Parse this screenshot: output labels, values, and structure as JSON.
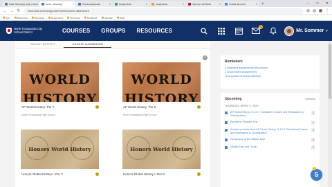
{
  "browser": {
    "tabs": [
      {
        "label": "Public Schoology Login | Schoo",
        "color": "#3f7fc0",
        "active": false
      },
      {
        "label": "Home | Schoology",
        "color": "#3f7fc0",
        "active": true
      },
      {
        "label": "Course Assignment",
        "color": "#3f7fc0",
        "active": false
      },
      {
        "label": "Google Drive",
        "color": "#1fa463",
        "active": false
      },
      {
        "label": "Assignments",
        "color": "#e7a33c",
        "active": false
      },
      {
        "label": "Sommer's AP World",
        "color": "#c8102e",
        "active": false
      },
      {
        "label": "Untitled document",
        "color": "#4285f4",
        "active": false
      }
    ],
    "url": "ntschools.schoology.com/home/course-dashboard",
    "bookmarks": [
      "Apps",
      "Bookmarks",
      "Schoology",
      "Google Drive",
      "AP Central",
      "Gradebook",
      "Calendar",
      "Other"
    ]
  },
  "header": {
    "district": "North Tonawanda City School District",
    "nav": [
      "COURSES",
      "GROUPS",
      "RESOURCES"
    ],
    "message_count": "3",
    "user": "Mr. Sommer"
  },
  "main": {
    "tabs": [
      "RECENT ACTIVITY",
      "COURSE DASHBOARD"
    ],
    "cards": [
      {
        "title": "AP World History: Per 7",
        "subtitle": "North Tonawanda High School",
        "image_text": [
          "WORLD",
          "HISTORY"
        ]
      },
      {
        "title": "AP World History: Per 5",
        "subtitle": "North Tonawanda High School",
        "image_text": [
          "WORLD",
          "HISTORY"
        ]
      },
      {
        "title": "Honors Global History I: Per 2",
        "subtitle": "",
        "image_text": [
          "Honors World History"
        ]
      },
      {
        "title": "Honors Global History I: Per 8",
        "subtitle": "",
        "image_text": [
          "Honors World History"
        ]
      }
    ]
  },
  "side": {
    "reminders_title": "Reminders",
    "reminders": [
      "4 ungraded assignments/discussions",
      "2 unsubmitted assignments",
      "16 ungraded test/quiz attempts"
    ],
    "upcoming_title": "Upcoming",
    "calendar_link": "Calendar",
    "date": "THURSDAY, APRIL 9, 2020",
    "events": [
      {
        "text": "AP World History: 5.4-5.7 Globalized Culture and Resistance to Globalization",
        "count": "1"
      },
      {
        "text": "Byzantine Practice Test",
        "count": "1"
      },
      {
        "text": "Content practice from AP World History: 5.4-5.7 Globalized Culture and Resistance to Globalization",
        "count": "1"
      },
      {
        "text": "Geography of the Middle East",
        "count": "2"
      },
      {
        "text": "Middle East and Trade",
        "count": "2"
      }
    ]
  },
  "help_label": "S",
  "colors": {
    "header": "#113067",
    "link": "#4a86c5",
    "accent": "#f2c200"
  }
}
